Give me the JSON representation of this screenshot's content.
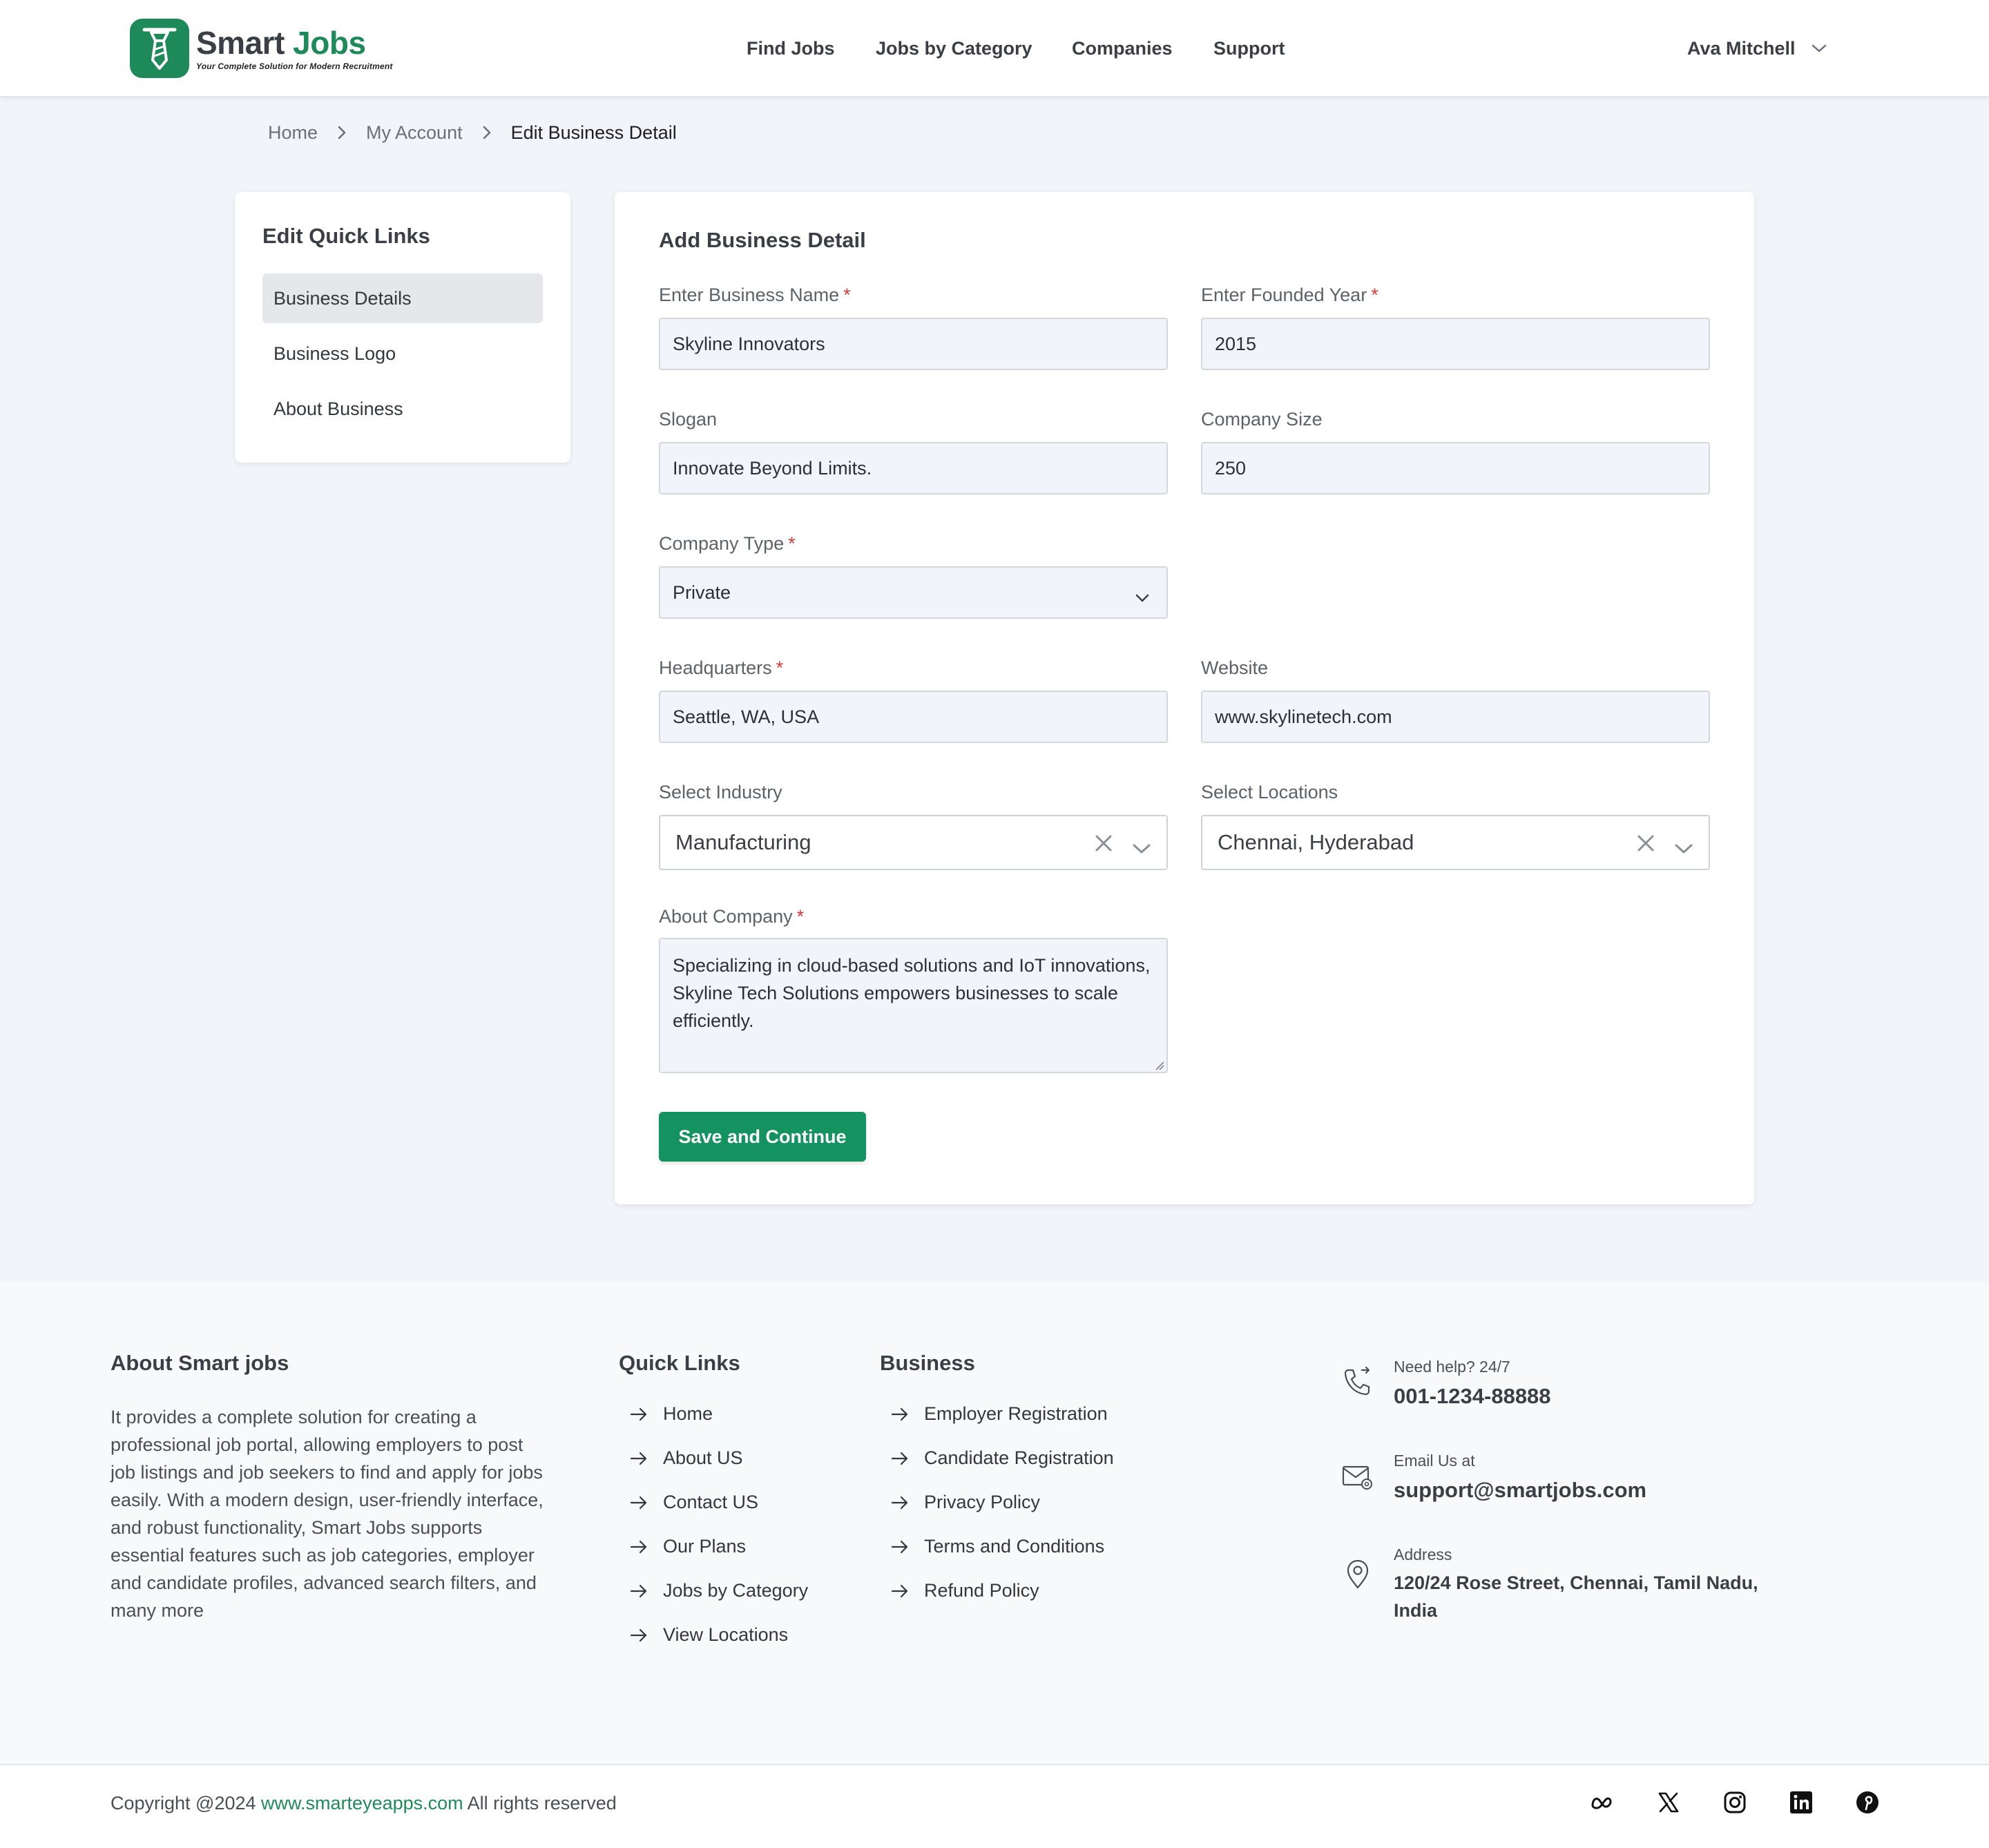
{
  "brand": {
    "name_part1": "Smart",
    "name_part2": "Jobs",
    "tagline": "Your Complete Solution for Modern Recruitment",
    "accent_color": "#1e8a5a",
    "logo_icon": "tie-icon"
  },
  "nav": {
    "items": [
      {
        "label": "Find Jobs"
      },
      {
        "label": "Jobs by Category"
      },
      {
        "label": "Companies"
      },
      {
        "label": "Support"
      }
    ]
  },
  "user": {
    "name": "Ava Mitchell",
    "icon": "chevron-down-icon"
  },
  "breadcrumb": {
    "items": [
      {
        "label": "Home"
      },
      {
        "label": "My Account"
      }
    ],
    "current": "Edit Business Detail"
  },
  "sidebar": {
    "title": "Edit Quick Links",
    "items": [
      {
        "label": "Business Details",
        "active": true
      },
      {
        "label": "Business Logo",
        "active": false
      },
      {
        "label": "About Business",
        "active": false
      }
    ]
  },
  "form": {
    "title": "Add Business Detail",
    "business_name": {
      "label": "Enter Business Name",
      "value": "Skyline Innovators",
      "required": "*"
    },
    "founded_year": {
      "label": "Enter Founded Year",
      "value": "2015",
      "required": "*"
    },
    "slogan": {
      "label": "Slogan",
      "value": "Innovate Beyond Limits."
    },
    "company_size": {
      "label": "Company Size",
      "value": "250"
    },
    "company_type": {
      "label": "Company Type",
      "value": "Private",
      "required": "*"
    },
    "headquarters": {
      "label": "Headquarters",
      "value": "Seattle, WA, USA",
      "required": "*"
    },
    "website": {
      "label": "Website",
      "value": "www.skylinetech.com"
    },
    "industry": {
      "label": "Select Industry",
      "value": "Manufacturing"
    },
    "locations": {
      "label": "Select Locations",
      "value": "Chennai, Hyderabad"
    },
    "about": {
      "label": "About Company",
      "value": "Specializing in cloud-based solutions and IoT innovations, Skyline Tech Solutions empowers businesses to scale efficiently.",
      "required": "*"
    },
    "save_label": "Save and Continue",
    "button_color": "#14925f"
  },
  "footer": {
    "about_title": "About Smart jobs",
    "about_text": "It provides a complete solution for creating a professional job portal, allowing employers to post job listings and job seekers to find and apply for jobs easily. With a modern design, user-friendly interface, and robust functionality, Smart Jobs supports essential features such as job categories, employer and candidate profiles, advanced search filters, and many more",
    "quick_links_title": "Quick Links",
    "quick_links": [
      {
        "label": "Home"
      },
      {
        "label": "About US"
      },
      {
        "label": "Contact US"
      },
      {
        "label": "Our Plans"
      },
      {
        "label": "Jobs by Category"
      },
      {
        "label": "View Locations"
      }
    ],
    "business_title": "Business",
    "business_links": [
      {
        "label": "Employer Registration"
      },
      {
        "label": "Candidate Registration"
      },
      {
        "label": "Privacy Policy"
      },
      {
        "label": "Terms and Conditions"
      },
      {
        "label": "Refund Policy"
      }
    ],
    "contact": {
      "help_label": "Need help? 24/7",
      "phone": "001-1234-88888",
      "email_label": "Email Us at",
      "email": "support@smartjobs.com",
      "address_label": "Address",
      "address": "120/24 Rose Street, Chennai, Tamil Nadu, India"
    },
    "copyright_prefix": "Copyright @2024",
    "copyright_site": "www.smarteyeapps.com",
    "copyright_suffix": "All rights reserved",
    "social_icons": [
      "meta-icon",
      "x-icon",
      "instagram-icon",
      "linkedin-icon",
      "pinterest-icon"
    ]
  }
}
